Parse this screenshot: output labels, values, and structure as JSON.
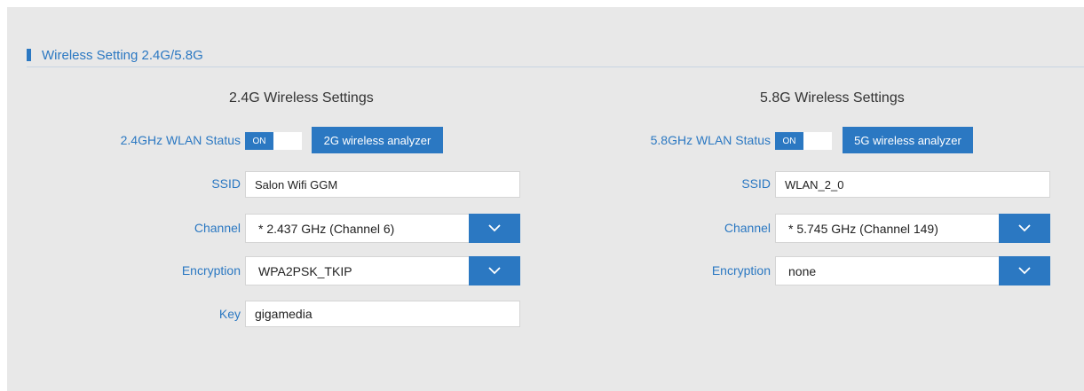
{
  "section": {
    "title": "Wireless Setting 2.4G/5.8G"
  },
  "band24": {
    "title": "2.4G Wireless Settings",
    "status_label": "2.4GHz WLAN Status",
    "toggle_on": "ON",
    "analyzer_label": "2G wireless analyzer",
    "ssid_label": "SSID",
    "ssid_value": "Salon Wifi GGM",
    "channel_label": "Channel",
    "channel_value": "* 2.437 GHz (Channel 6)",
    "encryption_label": "Encryption",
    "encryption_value": "WPA2PSK_TKIP",
    "key_label": "Key",
    "key_value": "gigamedia"
  },
  "band58": {
    "title": "5.8G Wireless Settings",
    "status_label": "5.8GHz WLAN Status",
    "toggle_on": "ON",
    "analyzer_label": "5G wireless analyzer",
    "ssid_label": "SSID",
    "ssid_value": "WLAN_2_0",
    "channel_label": "Channel",
    "channel_value": "* 5.745 GHz (Channel 149)",
    "encryption_label": "Encryption",
    "encryption_value": "none"
  },
  "colors": {
    "accent": "#2b78c2",
    "panel_bg": "#e8e8e8"
  }
}
